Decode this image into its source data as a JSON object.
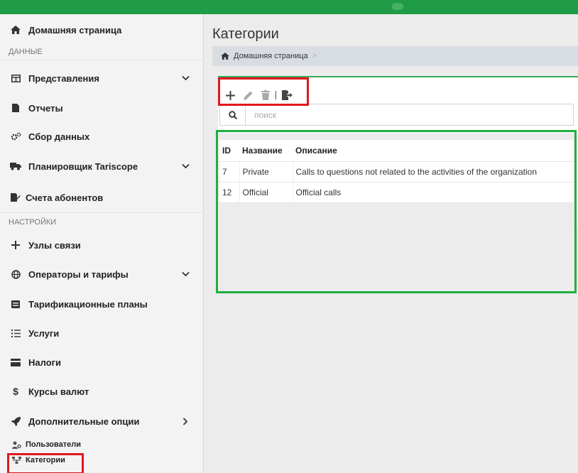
{
  "sidebar": {
    "home": "Домашняя страница",
    "section_data": "ДАННЫЕ",
    "views": "Представления",
    "reports": "Отчеты",
    "data_collection": "Сбор данных",
    "scheduler": "Планировщик Tariscope",
    "subscriber_accounts": "Счета абонентов",
    "section_settings": "НАСТРОЙКИ",
    "comm_nodes": "Узлы связи",
    "operators_tariffs": "Операторы и тарифы",
    "tariff_plans": "Тарификационные планы",
    "services": "Услуги",
    "taxes": "Налоги",
    "currency_rates": "Курсы валют",
    "extra_options": "Дополнительные опции",
    "users": "Пользователи",
    "categories": "Категории"
  },
  "main": {
    "title": "Категории",
    "breadcrumb_home": "Домашняя страница",
    "breadcrumb_sep": ">",
    "search_placeholder": "поиск"
  },
  "table": {
    "headers": {
      "id": "ID",
      "name": "Название",
      "description": "Описание"
    },
    "rows": [
      {
        "id": "7",
        "name": "Private",
        "description": "Calls to questions not related to the activities of the organization"
      },
      {
        "id": "12",
        "name": "Official",
        "description": "Official calls"
      }
    ]
  },
  "colors": {
    "topbar": "#1f9c45",
    "highlight_red": "#e0181e",
    "highlight_green": "#1db040"
  }
}
